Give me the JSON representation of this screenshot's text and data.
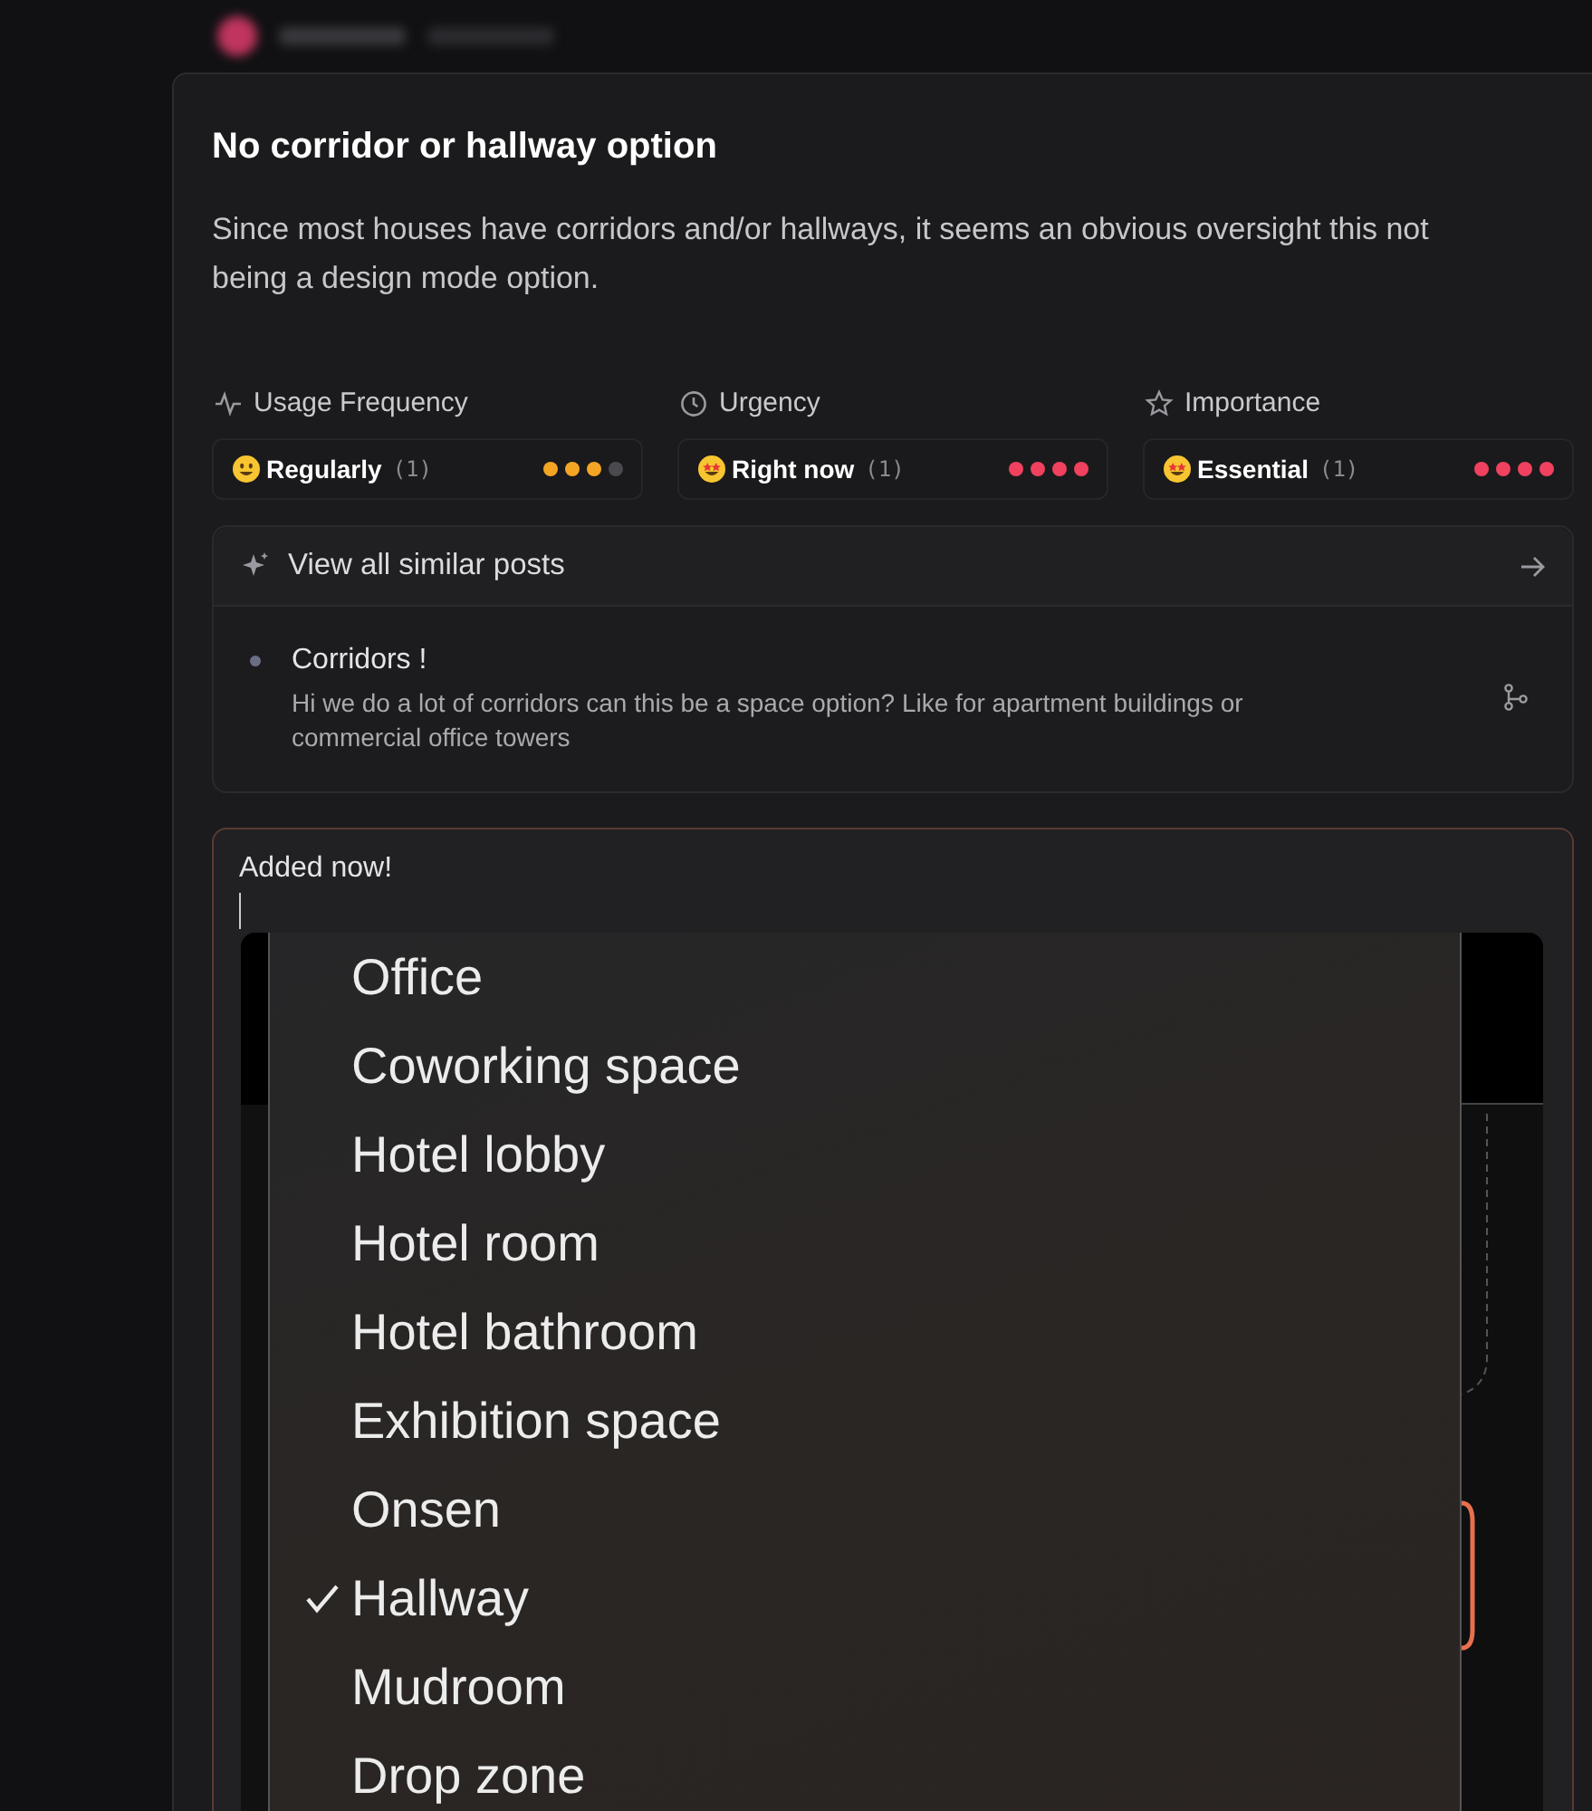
{
  "post": {
    "title": "No corridor or hallway option",
    "description": "Since most houses have corridors and/or hallways, it seems an obvious oversight this not being a design mode option."
  },
  "metrics": [
    {
      "kind": "frequency",
      "label": "Usage Frequency",
      "value": "Regularly",
      "count": "(1)",
      "stars": 3,
      "color": "#f5a524"
    },
    {
      "kind": "urgency",
      "label": "Urgency",
      "value": "Right now",
      "count": "(1)",
      "stars": 4,
      "color": "#f0415f"
    },
    {
      "kind": "importance",
      "label": "Importance",
      "value": "Essential",
      "count": "(1)",
      "stars": 4,
      "color": "#f0415f"
    }
  ],
  "similar_posts": {
    "header": "View all similar posts",
    "items": [
      {
        "title": "Corridors !",
        "body": "Hi we do a lot of corridors can this be a space option? Like for apartment buildings or commercial office towers"
      }
    ]
  },
  "comment": {
    "value": "Added now!",
    "screenshot": {
      "menu_items": [
        {
          "label": "Office",
          "selected": false
        },
        {
          "label": "Coworking space",
          "selected": false
        },
        {
          "label": "Hotel lobby",
          "selected": false
        },
        {
          "label": "Hotel room",
          "selected": false
        },
        {
          "label": "Hotel bathroom",
          "selected": false
        },
        {
          "label": "Exhibition space",
          "selected": false
        },
        {
          "label": "Onsen",
          "selected": false
        },
        {
          "label": "Hallway",
          "selected": true
        },
        {
          "label": "Mudroom",
          "selected": false
        },
        {
          "label": "Drop zone",
          "selected": false
        }
      ]
    }
  }
}
